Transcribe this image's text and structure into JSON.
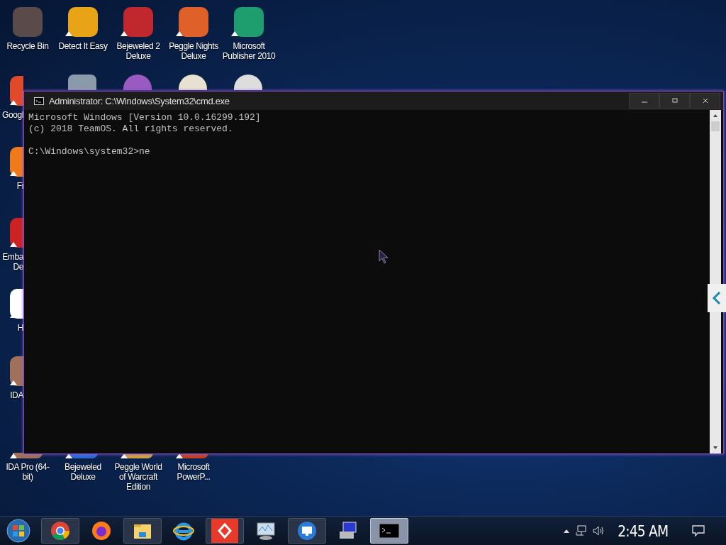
{
  "desktop": {
    "icons": [
      {
        "label": "Recycle Bin",
        "shortcut": false
      },
      {
        "label": "Detect It Easy",
        "shortcut": true
      },
      {
        "label": "Bejeweled 2 Deluxe",
        "shortcut": true
      },
      {
        "label": "Peggle Nights Deluxe",
        "shortcut": true
      },
      {
        "label": "Microsoft Publisher 2010",
        "shortcut": true
      },
      {
        "label": "Googl",
        "shortcut": true
      },
      {
        "label": "Fi",
        "shortcut": true
      },
      {
        "label": "Emba De",
        "shortcut": true
      },
      {
        "label": "H",
        "shortcut": true
      },
      {
        "label": "IDA",
        "shortcut": true
      },
      {
        "label": "IDA Pro (64-bit)",
        "shortcut": true
      },
      {
        "label": "Bejeweled Deluxe",
        "shortcut": true
      },
      {
        "label": "Peggle World of Warcraft Edition",
        "shortcut": true
      },
      {
        "label": "Microsoft PowerP...",
        "shortcut": true
      }
    ]
  },
  "window": {
    "title": "Administrator: C:\\Windows\\System32\\cmd.exe",
    "console": {
      "output": [
        "Microsoft Windows [Version 10.0.16299.192]",
        "(c) 2018 TeamOS. All rights reserved."
      ],
      "prompt": "C:\\Windows\\system32>ne"
    }
  },
  "taskbar": {
    "items": [
      {
        "selected": false
      },
      {
        "selected": false
      },
      {
        "selected": false
      },
      {
        "selected": false
      },
      {
        "selected": false
      },
      {
        "selected": false
      },
      {
        "selected": false
      },
      {
        "selected": false
      },
      {
        "selected": true
      }
    ],
    "clock": "2:45 AM"
  }
}
